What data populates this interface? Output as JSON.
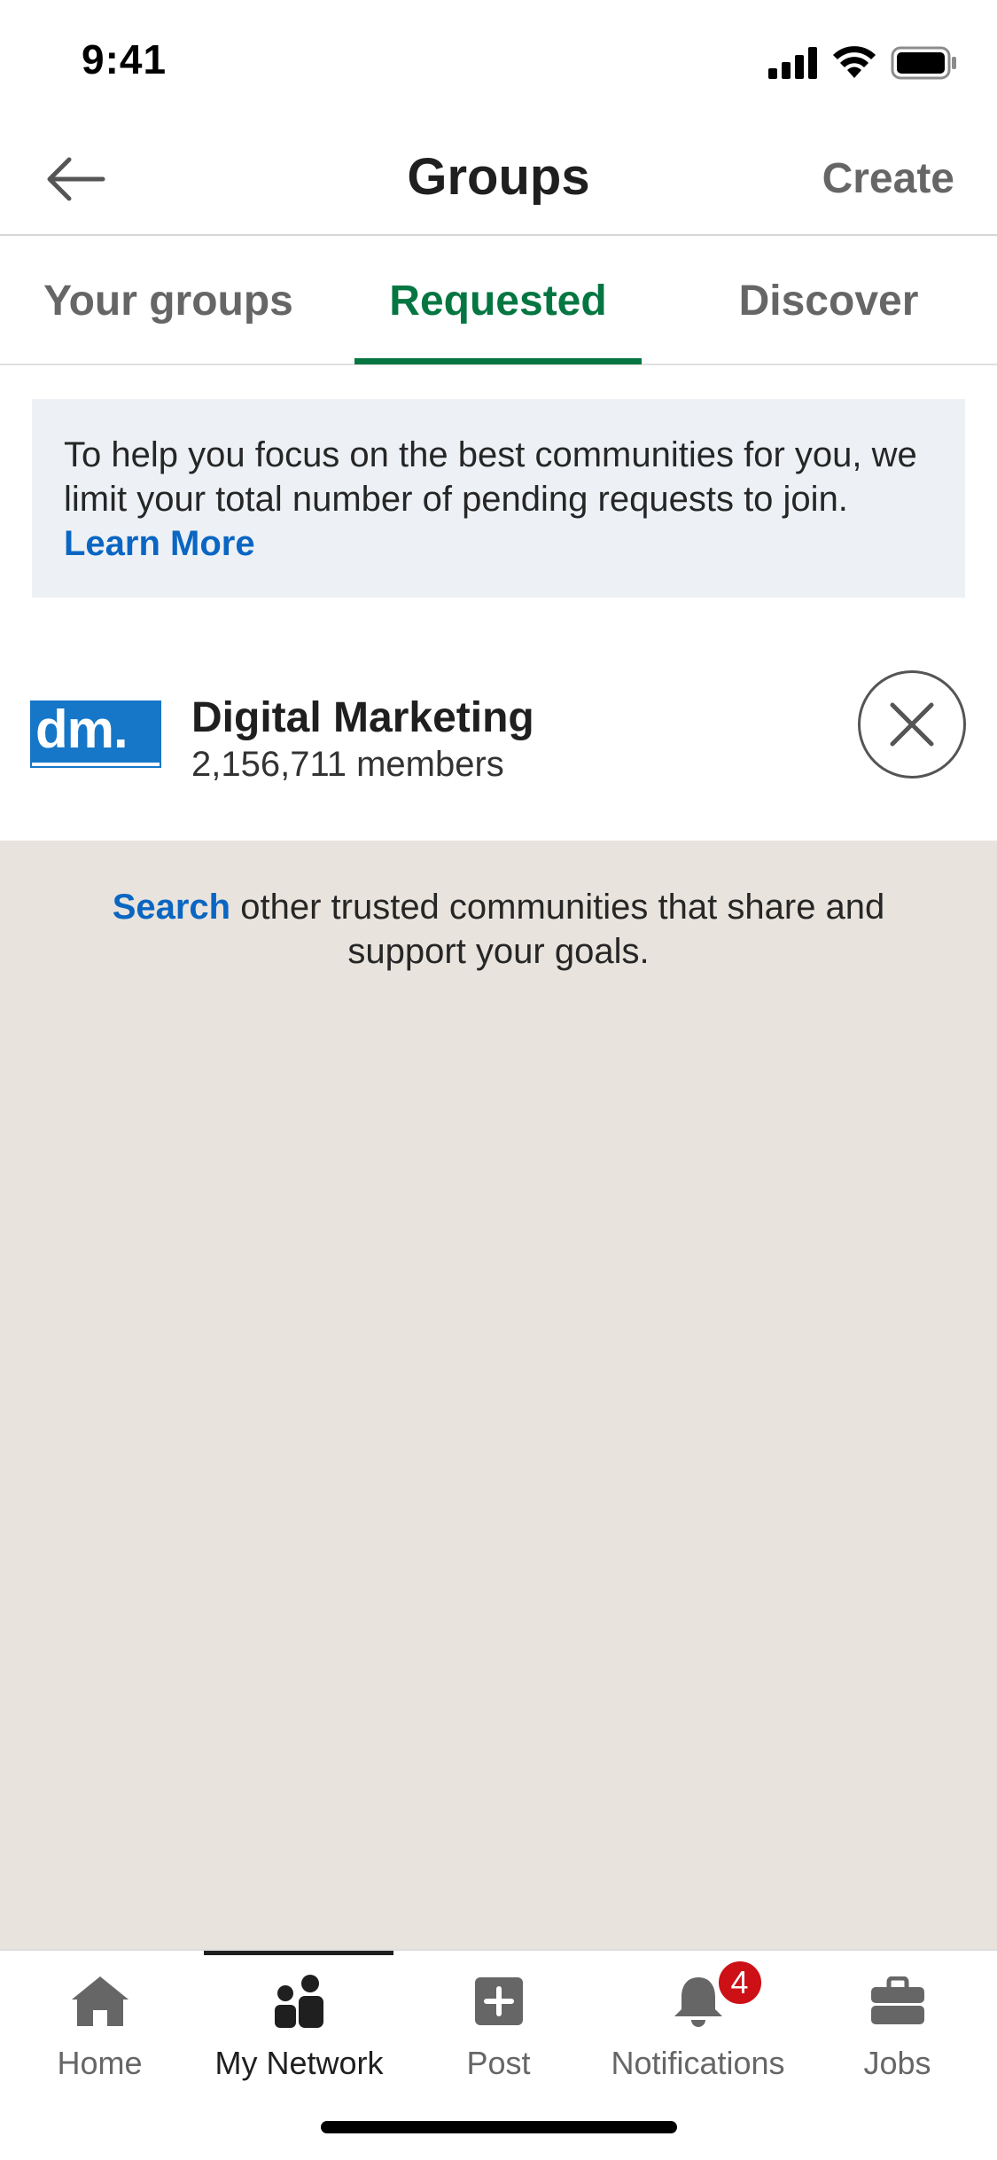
{
  "status_bar": {
    "time": "9:41"
  },
  "header": {
    "title": "Groups",
    "create_label": "Create"
  },
  "tabs": [
    {
      "label": "Your groups",
      "active": false
    },
    {
      "label": "Requested",
      "active": true
    },
    {
      "label": "Discover",
      "active": false
    }
  ],
  "banner": {
    "text": "To help you focus on the best communities for you, we limit your total number of pending requests to join.",
    "link": "Learn More"
  },
  "group": {
    "logo_text": "dm.",
    "name": "Digital Marketing",
    "members": "2,156,711 members"
  },
  "search_hint": {
    "link": "Search",
    "text": "other trusted communities that share and support your goals."
  },
  "bottom_nav": [
    {
      "label": "Home",
      "icon": "home-icon"
    },
    {
      "label": "My Network",
      "icon": "my-network-icon",
      "active": true
    },
    {
      "label": "Post",
      "icon": "post-icon"
    },
    {
      "label": "Notifications",
      "icon": "bell-icon",
      "badge": "4"
    },
    {
      "label": "Jobs",
      "icon": "briefcase-icon"
    }
  ],
  "colors": {
    "accent_green": "#057642",
    "link_blue": "#0a66c2",
    "badge_red": "#cc1016",
    "page_bg": "#e8e3dd"
  }
}
